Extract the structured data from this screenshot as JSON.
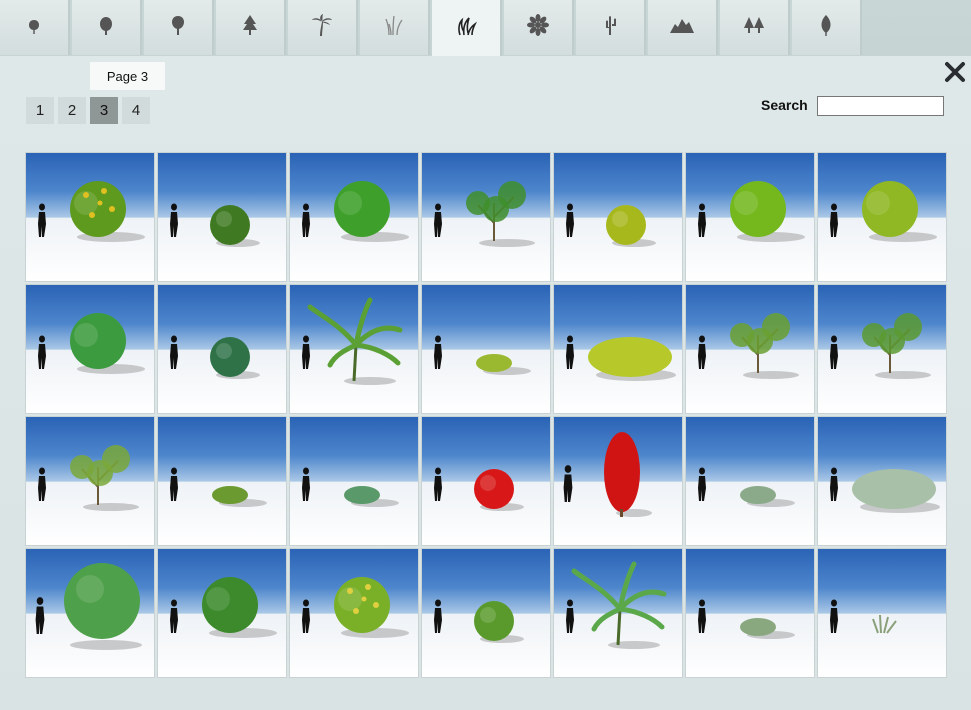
{
  "tabs": [
    {
      "name": "tab-small-tree",
      "icon": "small-tree-icon",
      "active": false
    },
    {
      "name": "tab-round-tree",
      "icon": "round-tree-icon",
      "active": false
    },
    {
      "name": "tab-broadleaf-tree",
      "icon": "broadleaf-tree-icon",
      "active": false
    },
    {
      "name": "tab-conifer",
      "icon": "conifer-icon",
      "active": false
    },
    {
      "name": "tab-palm",
      "icon": "palm-icon",
      "active": false
    },
    {
      "name": "tab-grass",
      "icon": "grass-icon",
      "active": false
    },
    {
      "name": "tab-shrub",
      "icon": "shrub-icon",
      "active": true
    },
    {
      "name": "tab-flower",
      "icon": "flower-icon",
      "active": false
    },
    {
      "name": "tab-cactus",
      "icon": "cactus-icon",
      "active": false
    },
    {
      "name": "tab-rocks",
      "icon": "rocks-icon",
      "active": false
    },
    {
      "name": "tab-forest",
      "icon": "forest-icon",
      "active": false
    },
    {
      "name": "tab-leaf",
      "icon": "leaf-icon",
      "active": false
    }
  ],
  "page_label": "Page 3",
  "pager": [
    {
      "label": "1",
      "active": false
    },
    {
      "label": "2",
      "active": false
    },
    {
      "label": "3",
      "active": true
    },
    {
      "label": "4",
      "active": false
    }
  ],
  "search": {
    "label": "Search",
    "value": "",
    "placeholder": ""
  },
  "close_icon": "close-icon",
  "thumbnails": [
    {
      "plant": "yellow-flowering-shrub",
      "color": "#5e9a1e",
      "accent": "#e0c020",
      "shape": "bush"
    },
    {
      "plant": "small-round-shrub",
      "color": "#3f7a22",
      "accent": "",
      "shape": "ball"
    },
    {
      "plant": "broad-leaf-shrub",
      "color": "#3ea02a",
      "accent": "",
      "shape": "bush"
    },
    {
      "plant": "sparse-leafy-shrub",
      "color": "#3f8e2c",
      "accent": "",
      "shape": "sparse"
    },
    {
      "plant": "yellow-ball-shrub",
      "color": "#a7b81c",
      "accent": "",
      "shape": "ball"
    },
    {
      "plant": "lime-bushy-shrub",
      "color": "#74b81e",
      "accent": "",
      "shape": "bush"
    },
    {
      "plant": "yellow-green-shrub",
      "color": "#8fb824",
      "accent": "",
      "shape": "bush"
    },
    {
      "plant": "green-clump-shrub",
      "color": "#3c9b3e",
      "accent": "",
      "shape": "bush"
    },
    {
      "plant": "dark-round-shrub",
      "color": "#2f7248",
      "accent": "",
      "shape": "ball"
    },
    {
      "plant": "banana-like-plant",
      "color": "#5aa034",
      "accent": "",
      "shape": "palm"
    },
    {
      "plant": "low-yellow-shrub",
      "color": "#9ab830",
      "accent": "",
      "shape": "low"
    },
    {
      "plant": "wide-yellow-shrub",
      "color": "#b6c82a",
      "accent": "",
      "shape": "wide"
    },
    {
      "plant": "tall-airy-shrub",
      "color": "#6aa030",
      "accent": "",
      "shape": "sparse"
    },
    {
      "plant": "arched-shrub",
      "color": "#5a9a30",
      "accent": "",
      "shape": "sparse"
    },
    {
      "plant": "small-airy-shrub",
      "color": "#7aa838",
      "accent": "",
      "shape": "sparse"
    },
    {
      "plant": "low-fern-shrub",
      "color": "#6a9a30",
      "accent": "",
      "shape": "low"
    },
    {
      "plant": "grey-green-groundcover",
      "color": "#5a9a6a",
      "accent": "",
      "shape": "low"
    },
    {
      "plant": "red-round-shrub",
      "color": "#d81818",
      "accent": "",
      "shape": "ball"
    },
    {
      "plant": "red-columnar-shrub",
      "color": "#d01414",
      "accent": "",
      "shape": "column"
    },
    {
      "plant": "small-sprout",
      "color": "#8aaa8a",
      "accent": "",
      "shape": "low"
    },
    {
      "plant": "silver-groundcover",
      "color": "#a8c0a8",
      "accent": "",
      "shape": "wide"
    },
    {
      "plant": "large-leafy-shrub",
      "color": "#4fa04a",
      "accent": "",
      "shape": "big"
    },
    {
      "plant": "dense-green-shrub",
      "color": "#3c8a2c",
      "accent": "",
      "shape": "bush"
    },
    {
      "plant": "yellow-flower-shrub",
      "color": "#7ab028",
      "accent": "#e0d040",
      "shape": "bush"
    },
    {
      "plant": "compact-green-shrub",
      "color": "#5a9a2c",
      "accent": "",
      "shape": "ball"
    },
    {
      "plant": "yucca-like-plant",
      "color": "#5aa84a",
      "accent": "",
      "shape": "palm"
    },
    {
      "plant": "grey-small-shrub",
      "color": "#8aa880",
      "accent": "",
      "shape": "low"
    },
    {
      "plant": "tiny-grass-tuft",
      "color": "#8aa07a",
      "accent": "",
      "shape": "tuft"
    }
  ]
}
